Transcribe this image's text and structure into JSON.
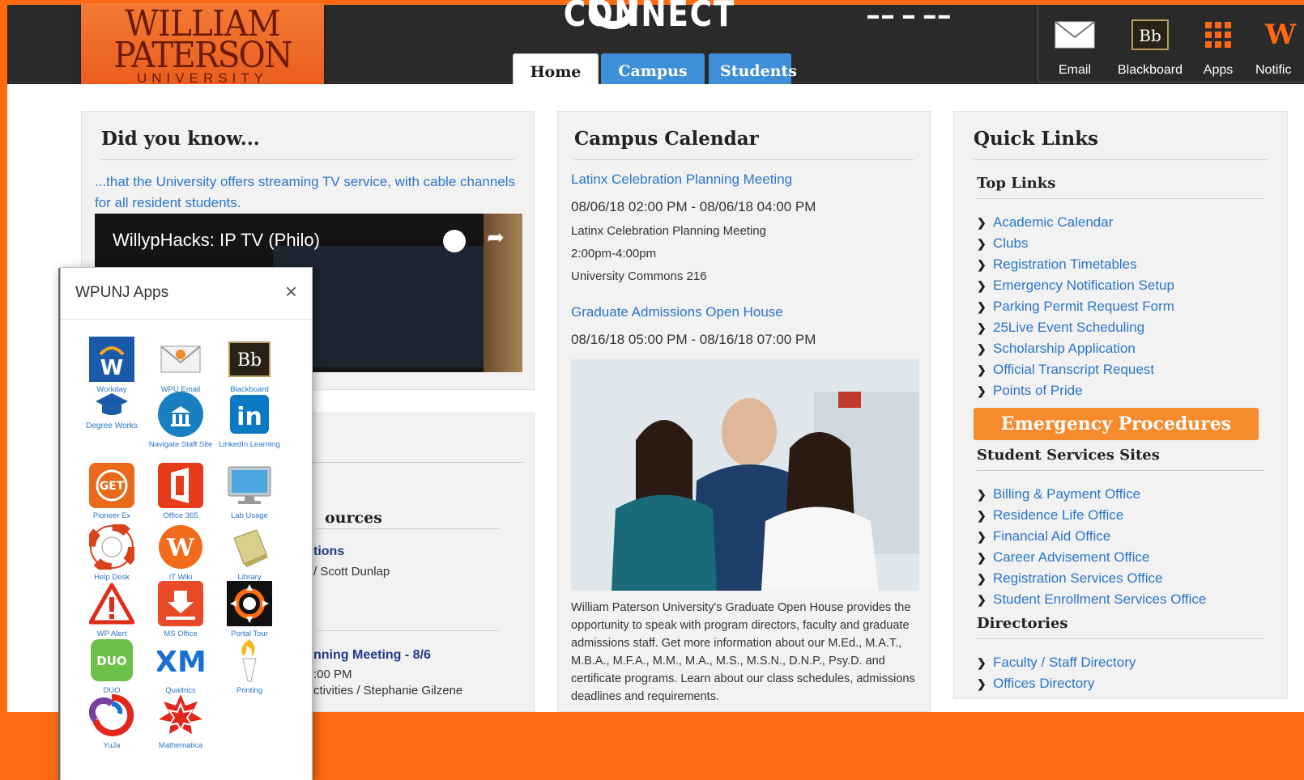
{
  "colors": {
    "brand_orange": "#ff6a13",
    "link_blue": "#2a76c8",
    "tab_blue": "#3d8fd8",
    "emergency": "#f68b2d"
  },
  "logo": {
    "line1": "WILLIAM",
    "line2": "PATERSON",
    "line3": "UNIVERSITY"
  },
  "header": {
    "connect": "CONNECT",
    "tabs": [
      {
        "label": "Home"
      },
      {
        "label": "Campus Life"
      },
      {
        "label": "Students"
      }
    ],
    "tools": [
      {
        "label": "Email",
        "icon": "envelope-icon"
      },
      {
        "label": "Blackboard",
        "icon": "blackboard-icon"
      },
      {
        "label": "Apps",
        "icon": "apps-grid-icon"
      },
      {
        "label": "Notific",
        "icon": "notifications-icon"
      }
    ]
  },
  "did_you_know": {
    "title": "Did you know...",
    "text": "...that the University offers streaming TV service, with cable channels for all resident students.",
    "video_title": "WillypHacks: IP TV (Philo)"
  },
  "lower_panel": {
    "resources": "ources",
    "item1_title": "tions",
    "item1_sub": "/ Scott Dunlap",
    "item2_title": "nning Meeting - 8/6",
    "item2_time": ":00 PM",
    "item2_sub": "ctivities / Stephanie Gilzene"
  },
  "calendar": {
    "title": "Campus Calendar",
    "events": [
      {
        "title": "Latinx Celebration Planning Meeting",
        "date": "08/06/18 02:00 PM - 08/06/18 04:00 PM",
        "lines": [
          "Latinx Celebration Planning Meeting",
          "2:00pm-4:00pm",
          "University Commons 216"
        ]
      },
      {
        "title": "Graduate Admissions Open House",
        "date": "08/16/18 05:00 PM - 08/16/18 07:00 PM",
        "description": "William Paterson University's Graduate Open House provides the opportunity to speak with program directors, faculty and graduate admissions staff. Get more information about our M.Ed., M.A.T., M.B.A., M.F.A., M.M., M.A., M.S., M.S.N., D.N.P., Psy.D. and certificate programs. Learn about our class schedules, admissions deadlines and requirements."
      }
    ]
  },
  "quick_links": {
    "title": "Quick Links",
    "top_links_heading": "Top Links",
    "top_links": [
      "Academic Calendar",
      "Clubs",
      "Registration Timetables",
      "Emergency Notification Setup",
      "Parking Permit Request Form",
      "25Live Event Scheduling",
      "Scholarship Application",
      "Official Transcript Request",
      "Points of Pride"
    ],
    "emergency_button": "Emergency Procedures",
    "student_services_heading": "Student Services Sites",
    "student_services": [
      "Billing & Payment Office",
      "Residence Life Office",
      "Financial Aid Office",
      "Career Advisement Office",
      "Registration Services Office",
      "Student Enrollment Services Office"
    ],
    "directories_heading": "Directories",
    "directories": [
      "Faculty / Staff Directory",
      "Offices Directory"
    ]
  },
  "apps_popup": {
    "title": "WPUNJ Apps",
    "close": "×",
    "apps": [
      {
        "name": "Workday",
        "icon": "workday-icon"
      },
      {
        "name": "WPU Email",
        "icon": "email-icon"
      },
      {
        "name": "Blackboard",
        "icon": "blackboard-icon"
      },
      {
        "name": "Degree Works",
        "icon": "graduation-cap-icon"
      },
      {
        "name": "Navigate Staff Site",
        "icon": "navigate-icon"
      },
      {
        "name": "LinkedIn Learning",
        "icon": "linkedin-icon"
      },
      {
        "name": "Pioneer Ex",
        "icon": "get-icon"
      },
      {
        "name": "Office 365",
        "icon": "office-icon"
      },
      {
        "name": "Lab Usage",
        "icon": "monitor-icon"
      },
      {
        "name": "Help Desk",
        "icon": "lifebuoy-icon"
      },
      {
        "name": "IT Wiki",
        "icon": "wiki-icon"
      },
      {
        "name": "Library",
        "icon": "book-icon"
      },
      {
        "name": "WP Alert",
        "icon": "alert-icon"
      },
      {
        "name": "MS Office",
        "icon": "download-icon"
      },
      {
        "name": "Portal Tour",
        "icon": "portal-tour-icon"
      },
      {
        "name": "DUO",
        "icon": "duo-icon"
      },
      {
        "name": "Qualtrics",
        "icon": "qualtrics-icon"
      },
      {
        "name": "Printing",
        "icon": "torch-icon"
      },
      {
        "name": "YuJa",
        "icon": "yuja-icon"
      },
      {
        "name": "Mathematica",
        "icon": "mathematica-icon"
      }
    ]
  }
}
